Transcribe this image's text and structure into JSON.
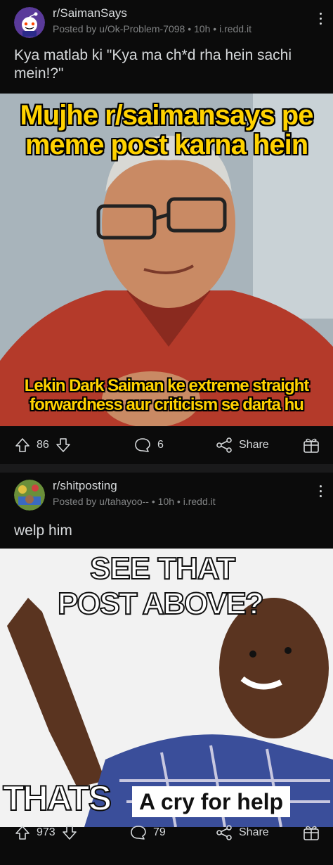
{
  "posts": [
    {
      "subreddit": "r/SaimanSays",
      "author": "Posted by u/Ok-Problem-7098",
      "age": "10h",
      "domain": "i.redd.it",
      "title": "Kya matlab ki \"Kya ma ch*d rha hein sachi mein!?\"",
      "meme_top": "Mujhe r/saimansays pe meme post karna hein",
      "meme_bottom": "Lekin Dark Saiman ke extreme straight forwardness aur criticism se darta hu",
      "votes": "86",
      "comments": "6",
      "share_label": "Share"
    },
    {
      "subreddit": "r/shitposting",
      "author": "Posted by u/tahayoo--",
      "age": "10h",
      "domain": "i.redd.it",
      "title": "welp him",
      "meme_top_line1": "SEE THAT",
      "meme_top_line2": "POST ABOVE?",
      "meme_bottom_left": "THATS",
      "meme_bottom_right": "A cry for help",
      "votes": "973",
      "comments": "79",
      "share_label": "Share"
    }
  ],
  "colors": {
    "bg": "#0b0b0b",
    "divider": "#1a1a1b",
    "text": "#d7dadc",
    "muted": "#818384",
    "meme_yellow": "#ffd200"
  },
  "icons": [
    "snoo-avatar-icon",
    "subreddit-avatar-icon",
    "more-options-icon",
    "upvote-icon",
    "downvote-icon",
    "comment-icon",
    "share-icon",
    "award-icon"
  ]
}
